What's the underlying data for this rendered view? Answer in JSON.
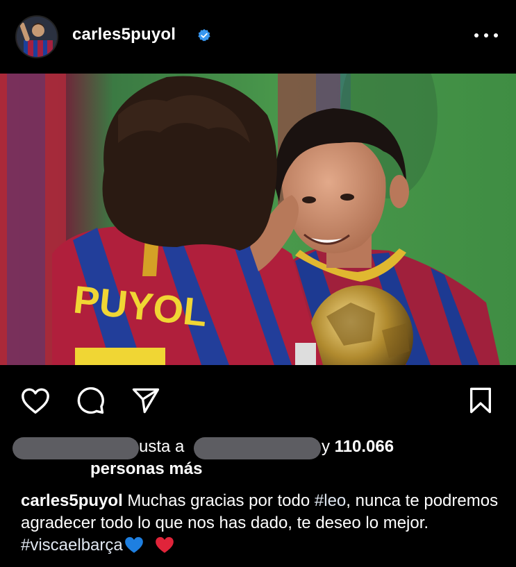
{
  "header": {
    "username": "carles5puyol",
    "verified": true,
    "avatar_icon": "profile-avatar",
    "more_icon": "more-options-icon"
  },
  "post": {
    "image_alt": "",
    "jersey_text": "PUYOL"
  },
  "actions": {
    "like_icon": "heart-icon",
    "comment_icon": "comment-icon",
    "share_icon": "send-icon",
    "save_icon": "bookmark-icon"
  },
  "likes": {
    "part1": "usta a",
    "part2": "y",
    "count": "110.066",
    "part3": "personas más"
  },
  "caption": {
    "username": "carles5puyol",
    "text1": "Muchas gracias por todo",
    "hashtag1": "#leo",
    "text2": ", nunca te podremos agradecer todo lo que nos has dado, te deseo lo mejor.",
    "hashtag2": "#viscaelbarça",
    "emoji1": "blue-heart",
    "emoji2": "red-heart"
  },
  "colors": {
    "background": "#000000",
    "verified": "#3897f0",
    "blue_heart": "#1e7fe0",
    "red_heart": "#e0243a"
  }
}
